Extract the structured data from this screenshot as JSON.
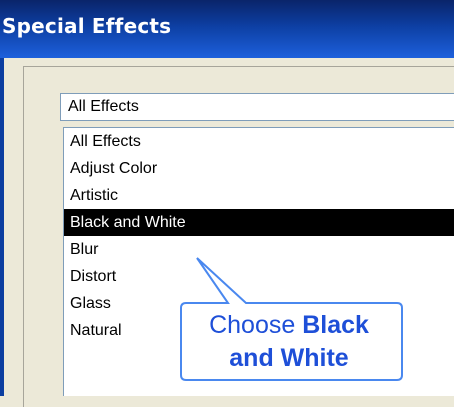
{
  "window": {
    "title": "Special Effects"
  },
  "filter_dropdown": {
    "value": "All Effects"
  },
  "effects_list": {
    "items": [
      "All Effects",
      "Adjust Color",
      "Artistic",
      "Black and White",
      "Blur",
      "Distort",
      "Glass",
      "Natural"
    ],
    "selected": "Black and White"
  },
  "callout": {
    "prefix": "Choose",
    "bold_part1": "Black",
    "bold_part2": "and White",
    "text_color": "#1e4fd8",
    "border_color": "#4a88ef"
  },
  "colors": {
    "title_bar": "#0d3fa3",
    "selection_bg": "#000000",
    "selection_fg": "#ffffff"
  }
}
